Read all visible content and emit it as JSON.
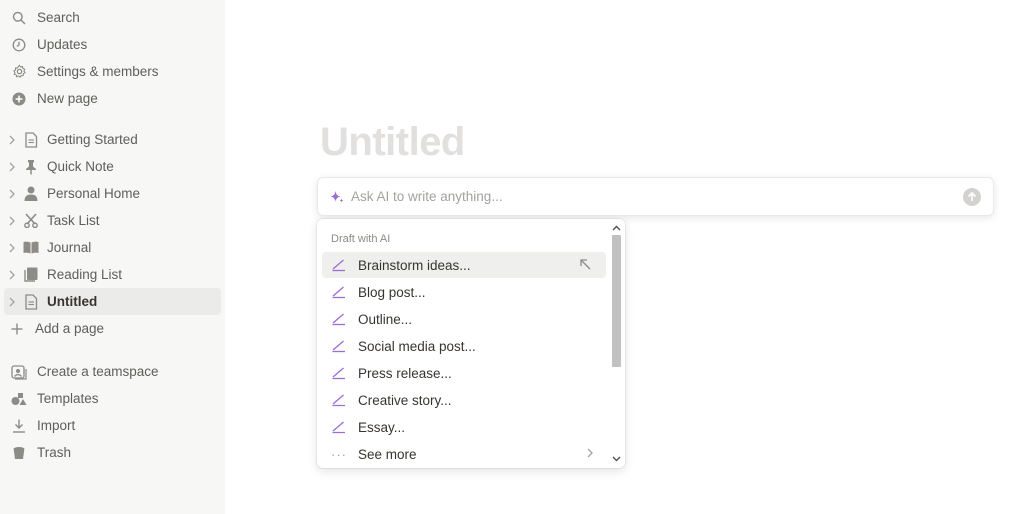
{
  "sidebar": {
    "top_items": [
      {
        "label": "Search",
        "icon": "search-icon"
      },
      {
        "label": "Updates",
        "icon": "clock-icon"
      },
      {
        "label": "Settings & members",
        "icon": "gear-icon"
      },
      {
        "label": "New page",
        "icon": "plus-circle-icon"
      }
    ],
    "pages": [
      {
        "label": "Getting Started",
        "icon": "document-icon"
      },
      {
        "label": "Quick Note",
        "icon": "pin-icon"
      },
      {
        "label": "Personal Home",
        "icon": "person-icon"
      },
      {
        "label": "Task List",
        "icon": "scissors-icon"
      },
      {
        "label": "Journal",
        "icon": "book-icon"
      },
      {
        "label": "Reading List",
        "icon": "notebook-icon"
      },
      {
        "label": "Untitled",
        "icon": "document-icon",
        "active": true
      }
    ],
    "add_page": "Add a page",
    "bottom_items": [
      {
        "label": "Create a teamspace",
        "icon": "teamspace-icon"
      },
      {
        "label": "Templates",
        "icon": "shapes-icon"
      },
      {
        "label": "Import",
        "icon": "download-icon"
      },
      {
        "label": "Trash",
        "icon": "trash-icon"
      }
    ]
  },
  "page": {
    "title": "Untitled"
  },
  "ai": {
    "placeholder": "Ask AI to write anything...",
    "menu_header": "Draft with AI",
    "items": [
      "Brainstorm ideas...",
      "Blog post...",
      "Outline...",
      "Social media post...",
      "Press release...",
      "Creative story...",
      "Essay..."
    ],
    "see_more": "See more"
  },
  "colors": {
    "accent_ai": "#9a6dd7",
    "sidebar_bg": "#f7f7f5",
    "title_placeholder": "#e1e0de"
  }
}
